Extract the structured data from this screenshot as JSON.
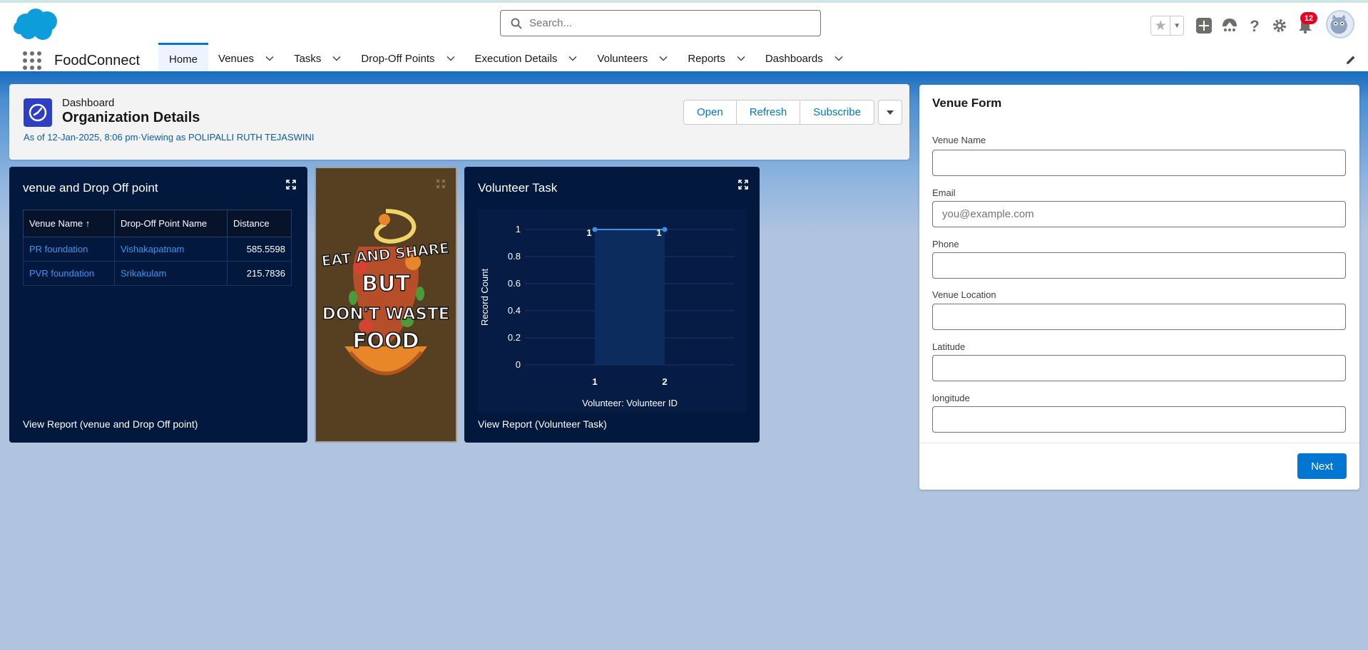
{
  "header": {
    "search_placeholder": "Search...",
    "notification_count": "12"
  },
  "nav": {
    "app_name": "FoodConnect",
    "tabs": [
      {
        "label": "Home",
        "active": true
      },
      {
        "label": "Venues"
      },
      {
        "label": "Tasks"
      },
      {
        "label": "Drop-Off Points"
      },
      {
        "label": "Execution Details"
      },
      {
        "label": "Volunteers"
      },
      {
        "label": "Reports"
      },
      {
        "label": "Dashboards"
      }
    ]
  },
  "dashboard": {
    "kind": "Dashboard",
    "title": "Organization Details",
    "meta": "As of 12-Jan-2025, 8:06 pm·Viewing as POLIPALLI RUTH TEJASWINI",
    "buttons": {
      "open": "Open",
      "refresh": "Refresh",
      "subscribe": "Subscribe"
    }
  },
  "venue_widget": {
    "title": "venue and Drop Off point",
    "columns": [
      "Venue Name ↑",
      "Drop-Off Point Name",
      "Distance"
    ],
    "rows": [
      {
        "venue": "PR foundation",
        "dropoff": "Vishakapatnam",
        "distance": "585.5598"
      },
      {
        "venue": "PVR foundation",
        "dropoff": "Srikakulam",
        "distance": "215.7836"
      }
    ],
    "footer": "View Report (venue and Drop Off point)"
  },
  "poster": {
    "lines": [
      "EAT AND SHARE",
      "BUT",
      "DON'T WASTE",
      "FOOD"
    ]
  },
  "volunteer_widget": {
    "title": "Volunteer Task",
    "footer": "View Report (Volunteer Task)"
  },
  "chart_data": {
    "type": "area",
    "title": "Volunteer Task",
    "xlabel": "Volunteer: Volunteer ID",
    "ylabel": "Record Count",
    "categories": [
      "1",
      "2"
    ],
    "values": [
      1,
      1
    ],
    "data_labels": [
      "1",
      "1"
    ],
    "ylim": [
      0,
      1
    ],
    "yticks": [
      "0",
      "0.2",
      "0.4",
      "0.6",
      "0.8",
      "1"
    ],
    "grid": true,
    "colors": {
      "line": "#3d8fe8",
      "fill": "#0c2c5e",
      "plot_bg": "#071c45"
    }
  },
  "form": {
    "title": "Venue Form",
    "fields": [
      {
        "label": "Venue Name",
        "value": "",
        "placeholder": ""
      },
      {
        "label": "Email",
        "value": "",
        "placeholder": "you@example.com"
      },
      {
        "label": "Phone",
        "value": "",
        "placeholder": ""
      },
      {
        "label": "Venue Location",
        "value": "",
        "placeholder": ""
      },
      {
        "label": "Latitude",
        "value": "",
        "placeholder": ""
      },
      {
        "label": "longitude",
        "value": "",
        "placeholder": ""
      }
    ],
    "next_label": "Next"
  },
  "colors": {
    "brand": "#0176d3",
    "widget_bg": "#03183d",
    "link": "#3e95f0",
    "badge": "#ea001e"
  }
}
